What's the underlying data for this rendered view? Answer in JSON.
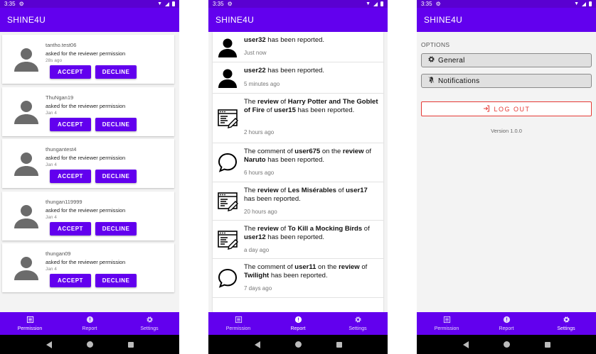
{
  "app": {
    "title": "SHINE4U",
    "status_time": "3:35"
  },
  "nav": {
    "permission": "Permission",
    "report": "Report",
    "settings": "Settings"
  },
  "permission_requests": [
    {
      "username": "tantho.test06",
      "message": "asked for the reviewer permission",
      "time": "28s ago",
      "accept": "ACCEPT",
      "decline": "DECLINE"
    },
    {
      "username": "ThuNgan19",
      "message": "asked for the reviewer permission",
      "time": "Jan 4",
      "accept": "ACCEPT",
      "decline": "DECLINE"
    },
    {
      "username": "thungantest4",
      "message": "asked for the reviewer permission",
      "time": "Jan 4",
      "accept": "ACCEPT",
      "decline": "DECLINE"
    },
    {
      "username": "thungan119999",
      "message": "asked for the reviewer permission",
      "time": "Jan 4",
      "accept": "ACCEPT",
      "decline": "DECLINE"
    },
    {
      "username": "thungan09",
      "message": "asked for the reviewer permission",
      "time": "Jan 4",
      "accept": "ACCEPT",
      "decline": "DECLINE"
    }
  ],
  "reports": [
    {
      "icon": "user-icon",
      "parts": [
        {
          "t": "user32",
          "b": true
        },
        {
          "t": " has been reported.",
          "b": false
        }
      ],
      "time": "Just now"
    },
    {
      "icon": "user-icon",
      "parts": [
        {
          "t": "user22",
          "b": true
        },
        {
          "t": " has been reported.",
          "b": false
        }
      ],
      "time": "5 minutes ago"
    },
    {
      "icon": "review-icon",
      "parts": [
        {
          "t": "The ",
          "b": false
        },
        {
          "t": "review",
          "b": true
        },
        {
          "t": " of ",
          "b": false
        },
        {
          "t": "Harry Potter and The Goblet of Fire",
          "b": true
        },
        {
          "t": " of ",
          "b": false
        },
        {
          "t": "user15",
          "b": true
        },
        {
          "t": " has been reported.",
          "b": false
        }
      ],
      "time": "2 hours ago"
    },
    {
      "icon": "comment-icon",
      "parts": [
        {
          "t": "The comment of ",
          "b": false
        },
        {
          "t": "user675",
          "b": true
        },
        {
          "t": " on the ",
          "b": false
        },
        {
          "t": "review",
          "b": true
        },
        {
          "t": " of ",
          "b": false
        },
        {
          "t": "Naruto",
          "b": true
        },
        {
          "t": " has been reported.",
          "b": false
        }
      ],
      "time": "6 hours ago"
    },
    {
      "icon": "review-icon",
      "parts": [
        {
          "t": "The ",
          "b": false
        },
        {
          "t": "review",
          "b": true
        },
        {
          "t": " of ",
          "b": false
        },
        {
          "t": "Les Misérables",
          "b": true
        },
        {
          "t": " of ",
          "b": false
        },
        {
          "t": "user17",
          "b": true
        },
        {
          "t": " has been reported.",
          "b": false
        }
      ],
      "time": "20 hours ago"
    },
    {
      "icon": "review-icon",
      "parts": [
        {
          "t": "The ",
          "b": false
        },
        {
          "t": "review",
          "b": true
        },
        {
          "t": " of ",
          "b": false
        },
        {
          "t": "To Kill a Mocking Birds",
          "b": true
        },
        {
          "t": " of ",
          "b": false
        },
        {
          "t": "user12",
          "b": true
        },
        {
          "t": " has been reported.",
          "b": false
        }
      ],
      "time": "a day ago"
    },
    {
      "icon": "comment-icon",
      "parts": [
        {
          "t": "The comment of ",
          "b": false
        },
        {
          "t": "user11",
          "b": true
        },
        {
          "t": " on the ",
          "b": false
        },
        {
          "t": "review",
          "b": true
        },
        {
          "t": " of ",
          "b": false
        },
        {
          "t": "Twilight",
          "b": true
        },
        {
          "t": " has been reported.",
          "b": false
        }
      ],
      "time": "7 days ago"
    }
  ],
  "settings": {
    "options_header": "OPTIONS",
    "general": "General",
    "notifications": "Notifications",
    "logout": "LOG OUT",
    "version": "Version 1.0.0"
  },
  "colors": {
    "primary": "#6200ee",
    "status_bar": "#5a00d1",
    "logout": "#e53935"
  }
}
